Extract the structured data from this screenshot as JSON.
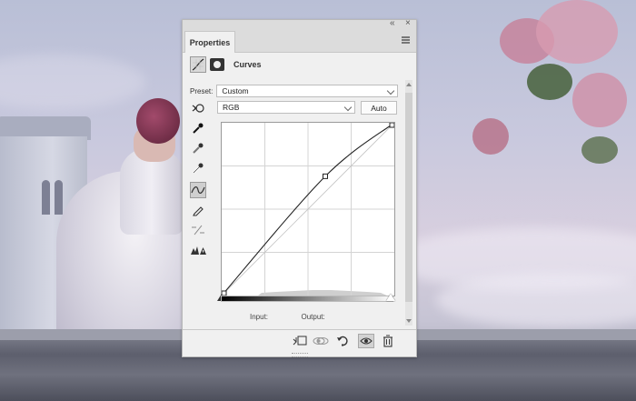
{
  "panel": {
    "tab_label": "Properties",
    "title": "Curves",
    "collapse_glyph": "«",
    "close_glyph": "×"
  },
  "preset": {
    "label": "Preset:",
    "value": "Custom"
  },
  "channel": {
    "value": "RGB",
    "auto_label": "Auto"
  },
  "io": {
    "input_label": "Input:",
    "output_label": "Output:"
  },
  "tools": [
    {
      "name": "on-image-adjust-icon"
    },
    {
      "name": "black-point-eyedropper-icon"
    },
    {
      "name": "gray-point-eyedropper-icon"
    },
    {
      "name": "white-point-eyedropper-icon"
    },
    {
      "name": "curve-points-icon",
      "active": true
    },
    {
      "name": "pencil-draw-icon"
    },
    {
      "name": "smooth-curve-icon"
    },
    {
      "name": "clipping-warning-icon"
    }
  ],
  "curve_points": [
    {
      "input": 0,
      "output": 0
    },
    {
      "input": 153,
      "output": 176
    },
    {
      "input": 255,
      "output": 255
    }
  ],
  "bottom_buttons": [
    {
      "name": "clip-to-layer-icon",
      "active": false
    },
    {
      "name": "view-previous-state-icon",
      "active": false
    },
    {
      "name": "reset-icon",
      "active": false
    },
    {
      "name": "toggle-visibility-icon",
      "active": true
    },
    {
      "name": "delete-icon",
      "active": false
    }
  ]
}
